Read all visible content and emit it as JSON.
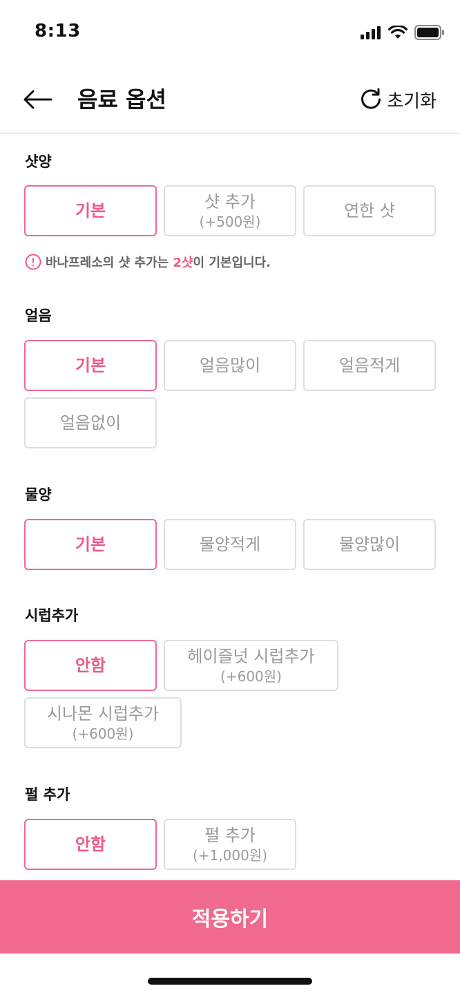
{
  "status": {
    "time": "8:13"
  },
  "header": {
    "title": "음료 옵션",
    "reset_label": "초기화"
  },
  "sections": {
    "shot": {
      "title": "샷양",
      "options": [
        {
          "label": "기본",
          "selected": true
        },
        {
          "label": "샷 추가",
          "price": "(+500원)",
          "selected": false
        },
        {
          "label": "연한 샷",
          "selected": false
        }
      ],
      "notice": {
        "prefix": "바나프레소의 샷 추가는 ",
        "highlight": "2샷",
        "suffix": "이 기본입니다."
      }
    },
    "ice": {
      "title": "얼음",
      "options": [
        {
          "label": "기본",
          "selected": true
        },
        {
          "label": "얼음많이",
          "selected": false
        },
        {
          "label": "얼음적게",
          "selected": false
        },
        {
          "label": "얼음없이",
          "selected": false
        }
      ]
    },
    "water": {
      "title": "물양",
      "options": [
        {
          "label": "기본",
          "selected": true
        },
        {
          "label": "물양적게",
          "selected": false
        },
        {
          "label": "물양많이",
          "selected": false
        }
      ]
    },
    "syrup": {
      "title": "시럽추가",
      "options": [
        {
          "label": "안함",
          "selected": true
        },
        {
          "label": "헤이즐넛 시럽추가",
          "price": "(+600원)",
          "selected": false
        },
        {
          "label": "시나몬 시럽추가",
          "price": "(+600원)",
          "selected": false
        }
      ]
    },
    "pearl": {
      "title": "펄 추가",
      "options": [
        {
          "label": "안함",
          "selected": true
        },
        {
          "label": "펄 추가",
          "price": "(+1,000원)",
          "selected": false
        }
      ]
    }
  },
  "footer": {
    "apply_label": "적용하기"
  },
  "colors": {
    "accent": "#EF5A86",
    "apply_bg": "#EF6A8E",
    "border": "#DEDEDE",
    "option_text": "#9A9A9A"
  },
  "icons": [
    "signal-icon",
    "wifi-icon",
    "battery-icon",
    "back-arrow-icon",
    "reset-icon",
    "info-icon"
  ]
}
